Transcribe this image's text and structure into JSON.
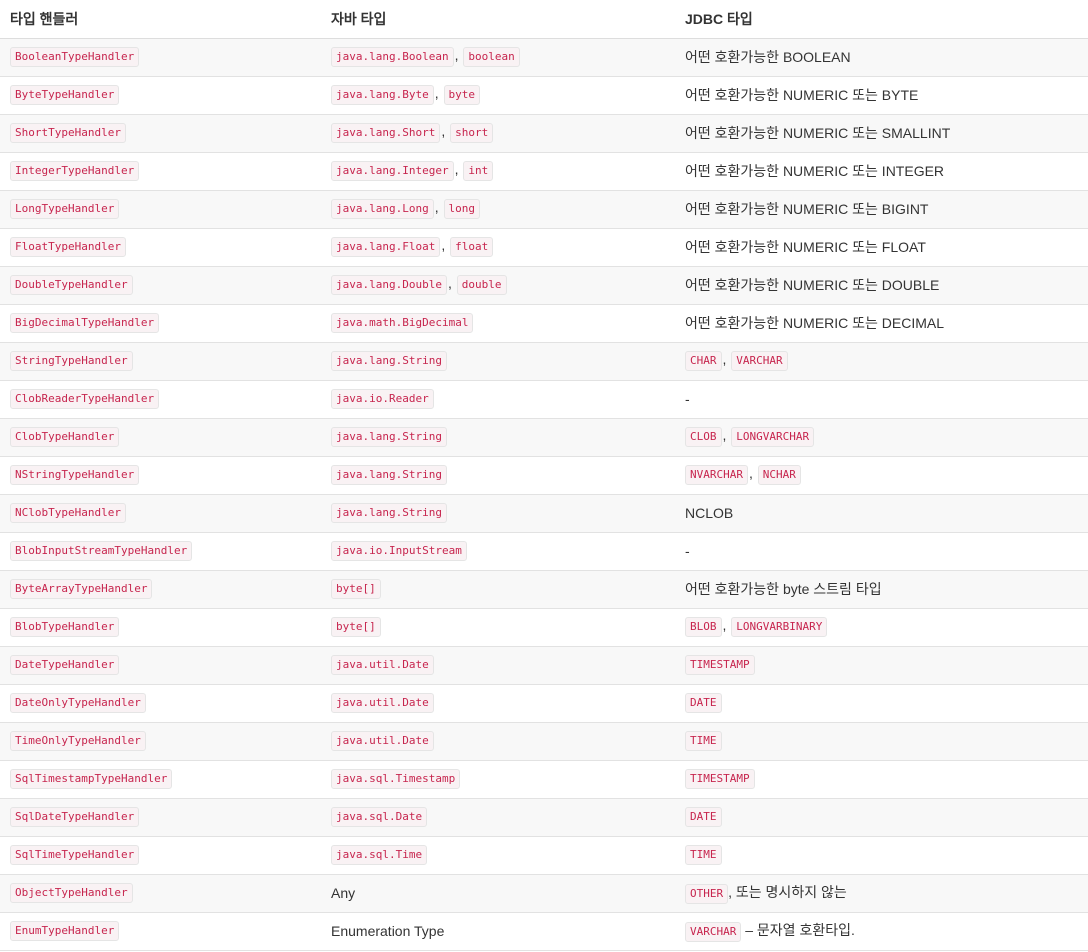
{
  "headers": [
    "타입 핸들러",
    "자바 타입",
    "JDBC 타입"
  ],
  "rows": [
    {
      "handler": "BooleanTypeHandler",
      "java": [
        {
          "t": "code",
          "v": "java.lang.Boolean"
        },
        {
          "t": "sep",
          "v": ", "
        },
        {
          "t": "code",
          "v": "boolean"
        }
      ],
      "jdbc": [
        {
          "t": "text",
          "v": "어떤 호환가능한 BOOLEAN"
        }
      ]
    },
    {
      "handler": "ByteTypeHandler",
      "java": [
        {
          "t": "code",
          "v": "java.lang.Byte"
        },
        {
          "t": "sep",
          "v": ", "
        },
        {
          "t": "code",
          "v": "byte"
        }
      ],
      "jdbc": [
        {
          "t": "text",
          "v": "어떤 호환가능한 NUMERIC 또는 BYTE"
        }
      ]
    },
    {
      "handler": "ShortTypeHandler",
      "java": [
        {
          "t": "code",
          "v": "java.lang.Short"
        },
        {
          "t": "sep",
          "v": ", "
        },
        {
          "t": "code",
          "v": "short"
        }
      ],
      "jdbc": [
        {
          "t": "text",
          "v": "어떤 호환가능한 NUMERIC 또는 SMALLINT"
        }
      ]
    },
    {
      "handler": "IntegerTypeHandler",
      "java": [
        {
          "t": "code",
          "v": "java.lang.Integer"
        },
        {
          "t": "sep",
          "v": ", "
        },
        {
          "t": "code",
          "v": "int"
        }
      ],
      "jdbc": [
        {
          "t": "text",
          "v": "어떤 호환가능한 NUMERIC 또는 INTEGER"
        }
      ]
    },
    {
      "handler": "LongTypeHandler",
      "java": [
        {
          "t": "code",
          "v": "java.lang.Long"
        },
        {
          "t": "sep",
          "v": ", "
        },
        {
          "t": "code",
          "v": "long"
        }
      ],
      "jdbc": [
        {
          "t": "text",
          "v": "어떤 호환가능한 NUMERIC 또는 BIGINT"
        }
      ]
    },
    {
      "handler": "FloatTypeHandler",
      "java": [
        {
          "t": "code",
          "v": "java.lang.Float"
        },
        {
          "t": "sep",
          "v": ", "
        },
        {
          "t": "code",
          "v": "float"
        }
      ],
      "jdbc": [
        {
          "t": "text",
          "v": "어떤 호환가능한 NUMERIC 또는 FLOAT"
        }
      ]
    },
    {
      "handler": "DoubleTypeHandler",
      "java": [
        {
          "t": "code",
          "v": "java.lang.Double"
        },
        {
          "t": "sep",
          "v": ", "
        },
        {
          "t": "code",
          "v": "double"
        }
      ],
      "jdbc": [
        {
          "t": "text",
          "v": "어떤 호환가능한 NUMERIC 또는 DOUBLE"
        }
      ]
    },
    {
      "handler": "BigDecimalTypeHandler",
      "java": [
        {
          "t": "code",
          "v": "java.math.BigDecimal"
        }
      ],
      "jdbc": [
        {
          "t": "text",
          "v": "어떤 호환가능한 NUMERIC 또는 DECIMAL"
        }
      ]
    },
    {
      "handler": "StringTypeHandler",
      "java": [
        {
          "t": "code",
          "v": "java.lang.String"
        }
      ],
      "jdbc": [
        {
          "t": "code",
          "v": "CHAR"
        },
        {
          "t": "sep",
          "v": ", "
        },
        {
          "t": "code",
          "v": "VARCHAR"
        }
      ]
    },
    {
      "handler": "ClobReaderTypeHandler",
      "java": [
        {
          "t": "code",
          "v": "java.io.Reader"
        }
      ],
      "jdbc": [
        {
          "t": "text",
          "v": "-"
        }
      ]
    },
    {
      "handler": "ClobTypeHandler",
      "java": [
        {
          "t": "code",
          "v": "java.lang.String"
        }
      ],
      "jdbc": [
        {
          "t": "code",
          "v": "CLOB"
        },
        {
          "t": "sep",
          "v": ", "
        },
        {
          "t": "code",
          "v": "LONGVARCHAR"
        }
      ]
    },
    {
      "handler": "NStringTypeHandler",
      "java": [
        {
          "t": "code",
          "v": "java.lang.String"
        }
      ],
      "jdbc": [
        {
          "t": "code",
          "v": "NVARCHAR"
        },
        {
          "t": "sep",
          "v": ", "
        },
        {
          "t": "code",
          "v": "NCHAR"
        }
      ]
    },
    {
      "handler": "NClobTypeHandler",
      "java": [
        {
          "t": "code",
          "v": "java.lang.String"
        }
      ],
      "jdbc": [
        {
          "t": "text",
          "v": "NCLOB"
        }
      ]
    },
    {
      "handler": "BlobInputStreamTypeHandler",
      "java": [
        {
          "t": "code",
          "v": "java.io.InputStream"
        }
      ],
      "jdbc": [
        {
          "t": "text",
          "v": "-"
        }
      ]
    },
    {
      "handler": "ByteArrayTypeHandler",
      "java": [
        {
          "t": "code",
          "v": "byte[]"
        }
      ],
      "jdbc": [
        {
          "t": "text",
          "v": "어떤 호환가능한 byte 스트림 타입"
        }
      ]
    },
    {
      "handler": "BlobTypeHandler",
      "java": [
        {
          "t": "code",
          "v": "byte[]"
        }
      ],
      "jdbc": [
        {
          "t": "code",
          "v": "BLOB"
        },
        {
          "t": "sep",
          "v": ", "
        },
        {
          "t": "code",
          "v": "LONGVARBINARY"
        }
      ]
    },
    {
      "handler": "DateTypeHandler",
      "java": [
        {
          "t": "code",
          "v": "java.util.Date"
        }
      ],
      "jdbc": [
        {
          "t": "code",
          "v": "TIMESTAMP"
        }
      ]
    },
    {
      "handler": "DateOnlyTypeHandler",
      "java": [
        {
          "t": "code",
          "v": "java.util.Date"
        }
      ],
      "jdbc": [
        {
          "t": "code",
          "v": "DATE"
        }
      ]
    },
    {
      "handler": "TimeOnlyTypeHandler",
      "java": [
        {
          "t": "code",
          "v": "java.util.Date"
        }
      ],
      "jdbc": [
        {
          "t": "code",
          "v": "TIME"
        }
      ]
    },
    {
      "handler": "SqlTimestampTypeHandler",
      "java": [
        {
          "t": "code",
          "v": "java.sql.Timestamp"
        }
      ],
      "jdbc": [
        {
          "t": "code",
          "v": "TIMESTAMP"
        }
      ]
    },
    {
      "handler": "SqlDateTypeHandler",
      "java": [
        {
          "t": "code",
          "v": "java.sql.Date"
        }
      ],
      "jdbc": [
        {
          "t": "code",
          "v": "DATE"
        }
      ]
    },
    {
      "handler": "SqlTimeTypeHandler",
      "java": [
        {
          "t": "code",
          "v": "java.sql.Time"
        }
      ],
      "jdbc": [
        {
          "t": "code",
          "v": "TIME"
        }
      ]
    },
    {
      "handler": "ObjectTypeHandler",
      "java": [
        {
          "t": "text",
          "v": "Any"
        }
      ],
      "jdbc": [
        {
          "t": "code",
          "v": "OTHER"
        },
        {
          "t": "text",
          "v": ", 또는 명시하지 않는"
        }
      ]
    },
    {
      "handler": "EnumTypeHandler",
      "java": [
        {
          "t": "text",
          "v": "Enumeration Type"
        }
      ],
      "jdbc": [
        {
          "t": "code",
          "v": "VARCHAR"
        },
        {
          "t": "text",
          "v": " – 문자열 호환타입."
        }
      ]
    }
  ]
}
